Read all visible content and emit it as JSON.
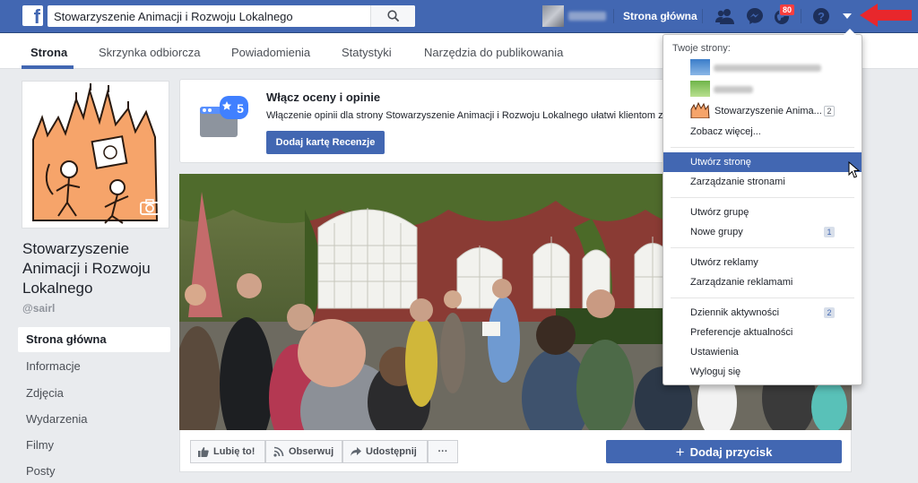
{
  "topbar": {
    "logo": "f",
    "search_value": "Stowarzyszenie Animacji i Rozwoju Lokalnego",
    "home_label": "Strona główna",
    "notifications_badge": "80",
    "bg_color": "#4267b2"
  },
  "tabs": [
    {
      "label": "Strona"
    },
    {
      "label": "Skrzynka odbiorcza"
    },
    {
      "label": "Powiadomienia"
    },
    {
      "label": "Statystyki"
    },
    {
      "label": "Narzędzia do publikowania"
    }
  ],
  "page": {
    "name": "Stowarzyszenie Animacji i Rozwoju Lokalnego",
    "handle": "@sairl"
  },
  "leftnav": [
    {
      "label": "Strona główna"
    },
    {
      "label": "Informacje"
    },
    {
      "label": "Zdjęcia"
    },
    {
      "label": "Wydarzenia"
    },
    {
      "label": "Filmy"
    },
    {
      "label": "Posty"
    }
  ],
  "reviews_card": {
    "star_count": "5",
    "title": "Włącz oceny i opinie",
    "description": "Włączenie opinii dla strony Stowarzyszenie Animacji i Rozwoju Lokalnego ułatwi klientom z",
    "button_label": "Dodaj kartę Recenzje"
  },
  "actions": {
    "like": "Lubię to!",
    "follow": "Obserwuj",
    "share": "Udostępnij",
    "more": "···",
    "add_button": "Dodaj przycisk"
  },
  "dropdown": {
    "header": "Twoje strony:",
    "pages": [
      {
        "label": "",
        "blurred": true
      },
      {
        "label": "",
        "blurred": true
      },
      {
        "label": "Stowarzyszenie Anima...",
        "badge": "2"
      }
    ],
    "see_more": "Zobacz więcej...",
    "groups": [
      {
        "items": [
          {
            "label": "Utwórz stronę",
            "highlighted": true
          },
          {
            "label": "Zarządzanie stronami"
          }
        ]
      },
      {
        "items": [
          {
            "label": "Utwórz grupę"
          },
          {
            "label": "Nowe grupy",
            "badge": "1"
          }
        ]
      },
      {
        "items": [
          {
            "label": "Utwórz reklamy"
          },
          {
            "label": "Zarządzanie reklamami"
          }
        ]
      },
      {
        "items": [
          {
            "label": "Dziennik aktywności",
            "badge": "2"
          },
          {
            "label": "Preferencje aktualności"
          },
          {
            "label": "Ustawienia"
          },
          {
            "label": "Wyloguj się"
          }
        ]
      }
    ]
  },
  "colors": {
    "accent": "#4267b2",
    "annotation_arrow": "#e8272c",
    "notification_badge": "#fa3e3e"
  }
}
